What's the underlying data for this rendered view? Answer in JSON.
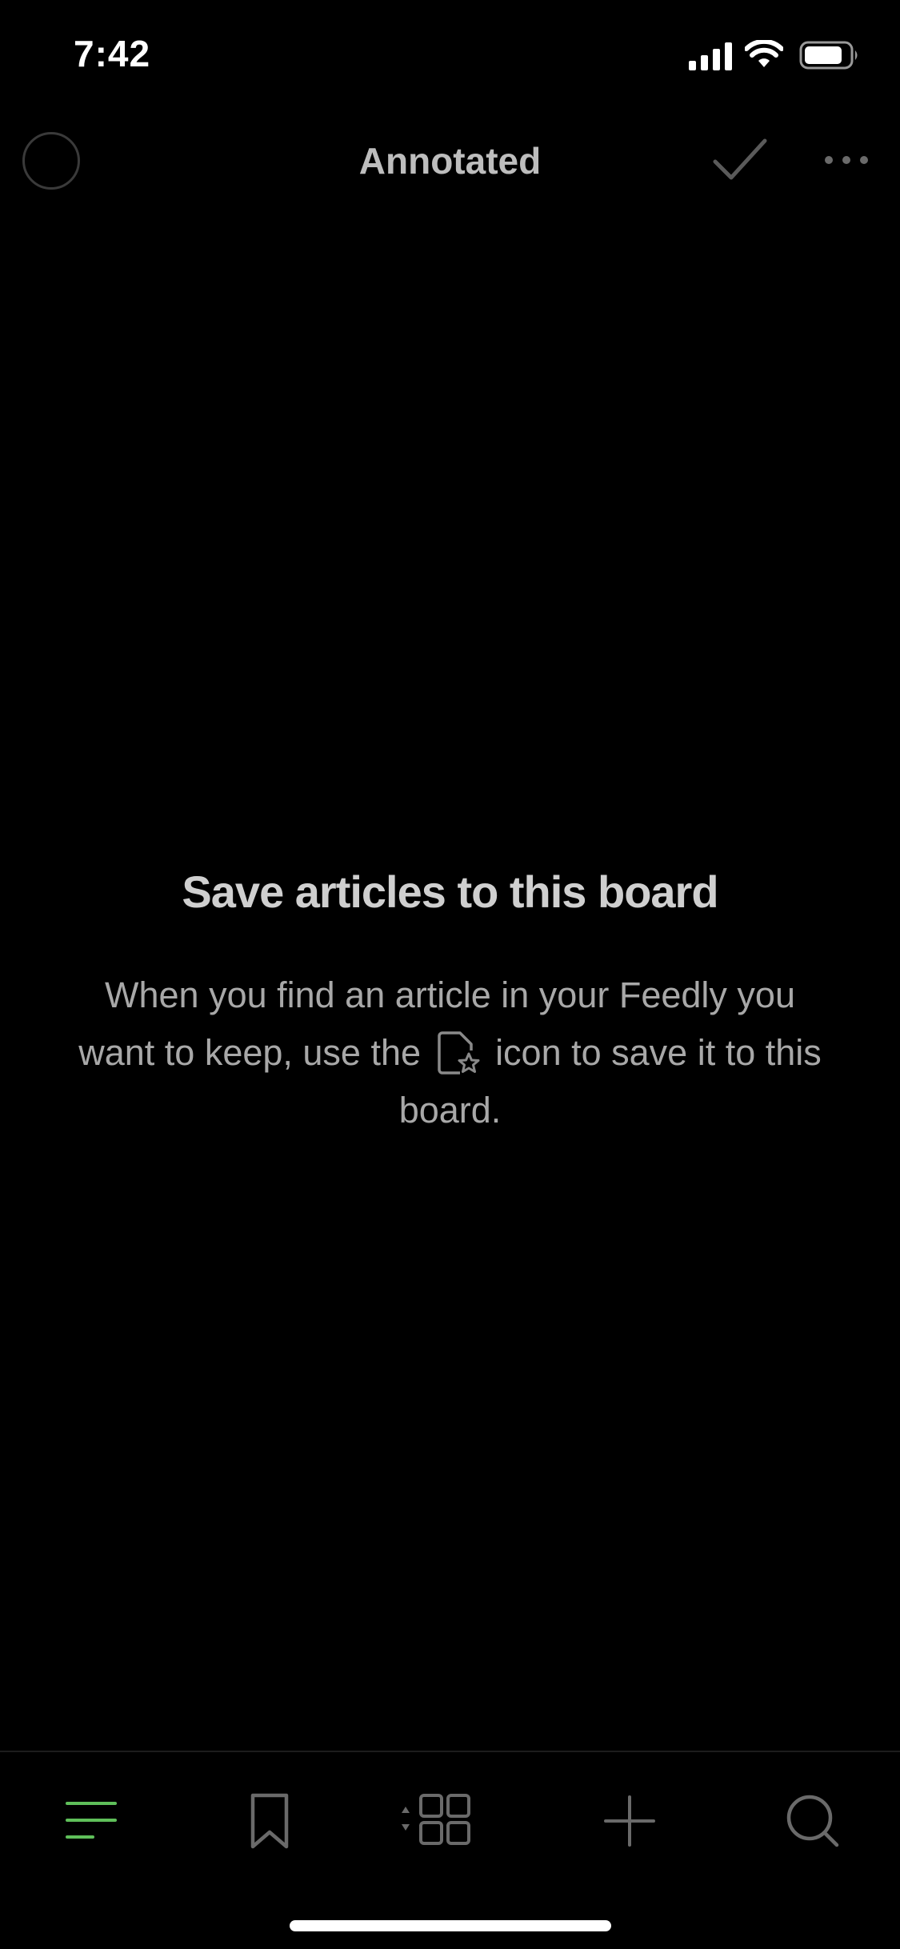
{
  "status_bar": {
    "time": "7:42",
    "icons": [
      "cellular-signal-icon",
      "wifi-icon",
      "battery-icon"
    ]
  },
  "nav_bar": {
    "title": "Annotated",
    "left_icon": "circle-icon",
    "right_icons": [
      "checkmark-icon",
      "more-icon"
    ]
  },
  "empty_state": {
    "title": "Save articles to this board",
    "body_before_icon": "When you find an article in your Feedly you want to keep, use the",
    "inline_icon": "save-to-board-icon",
    "body_after_icon": "icon to save it to this board."
  },
  "tab_bar": {
    "items": [
      {
        "icon": "menu-icon",
        "active": true
      },
      {
        "icon": "bookmark-icon",
        "active": false
      },
      {
        "icon": "grid-layout-icon",
        "active": false
      },
      {
        "icon": "plus-icon",
        "active": false
      },
      {
        "icon": "search-icon",
        "active": false
      }
    ]
  },
  "colors": {
    "background": "#000000",
    "active_tab": "#5fbf5a",
    "inactive_icon": "#6a6a6a",
    "title_text": "#bdbdbd",
    "body_text": "#a8a8a8"
  }
}
